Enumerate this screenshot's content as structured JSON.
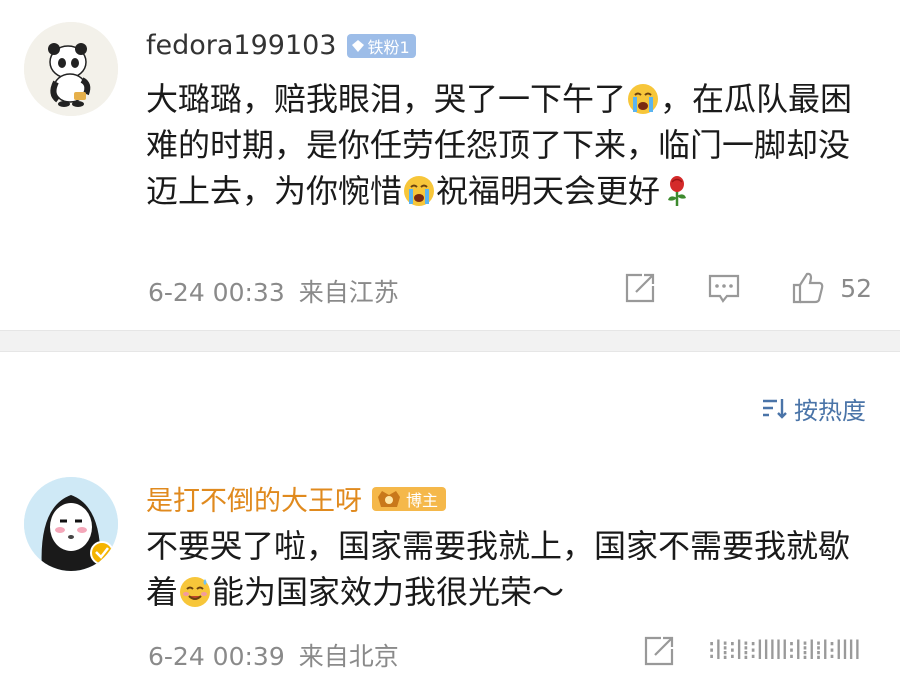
{
  "comments": [
    {
      "username": "fedora199103",
      "badge": "铁粉1",
      "content_parts": [
        "大璐璐，赔我眼泪，哭了一下午了",
        "，在瓜队最困难的时期，是你任劳任怨顶了下来，临门一脚却没迈上去，为你惋惜",
        "祝福明天会更好"
      ],
      "emojis": [
        "crying-face-emoji",
        "crying-face-emoji",
        "rose-emoji"
      ],
      "date": "6-24 00:33",
      "location": "来自江苏",
      "like_count": "52"
    },
    {
      "username": "是打不倒的大王呀",
      "badge": "博主",
      "content_parts": [
        "不要哭了啦，国家需要我就上，国家不需要我就歇着",
        "能为国家效力我很光荣～"
      ],
      "emojis": [
        "smiling-sweat-emoji"
      ],
      "date": "6-24 00:39",
      "location": "来自北京",
      "watermark": "⁝l⁞⁝l⁞⁝lllll⁝l⁞l⁞l⁝llll"
    }
  ],
  "sort": {
    "label": "按热度"
  },
  "colors": {
    "link": "#4a74a8",
    "host_name": "#e08a1e",
    "meta": "#8a8a8a",
    "fan_badge": "#9dbde8",
    "host_badge": "#f5b84a"
  }
}
